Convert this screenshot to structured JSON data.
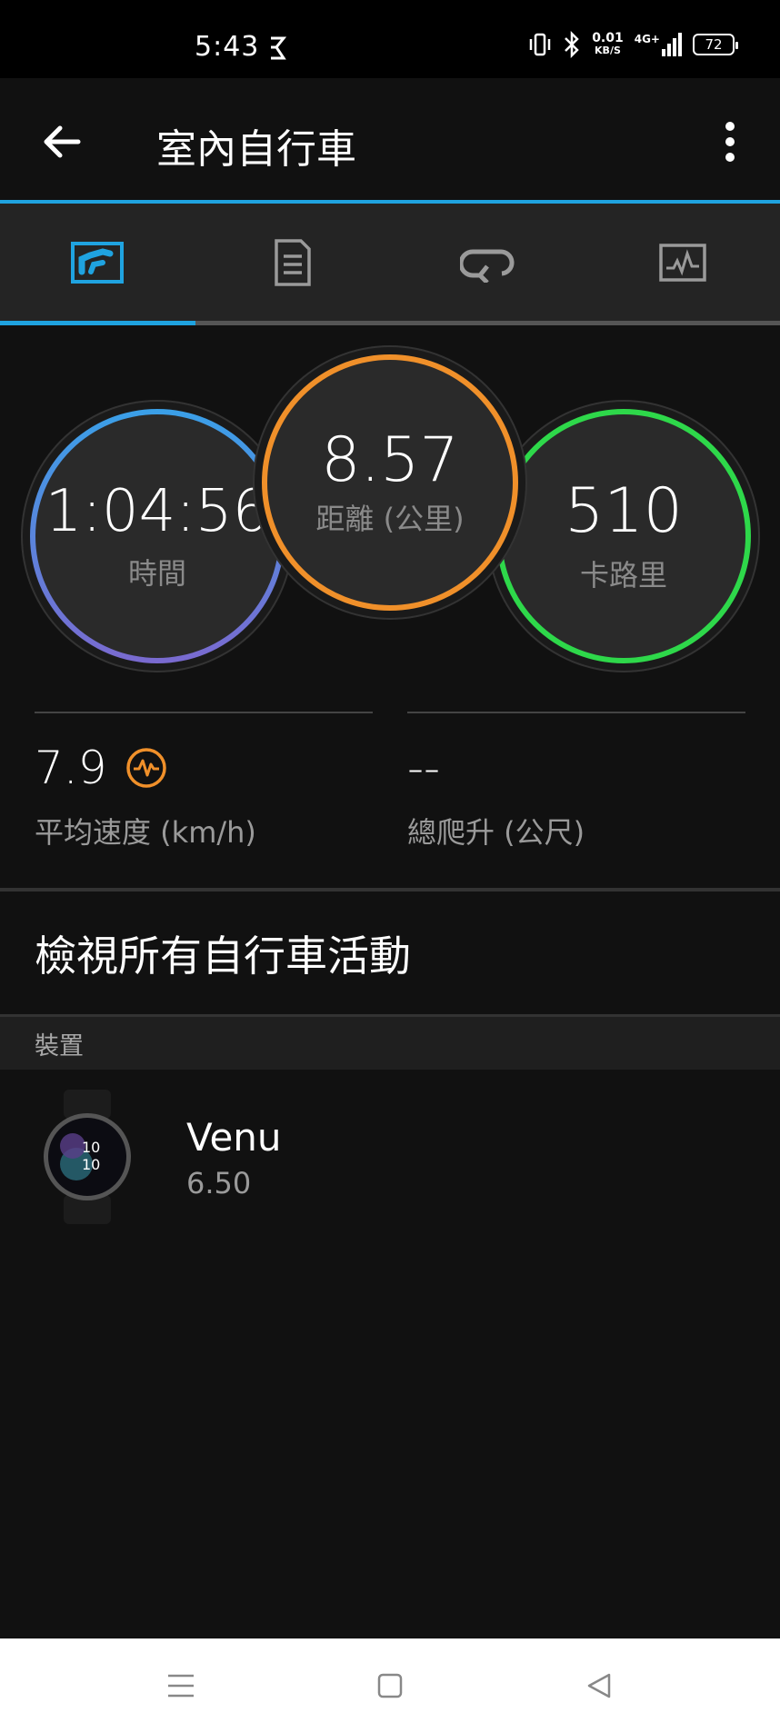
{
  "status_bar": {
    "time": "5:43",
    "net_speed_value": "0.01",
    "net_speed_unit": "KB/S",
    "network": "4G+",
    "battery": "72"
  },
  "app_bar": {
    "title": "室內自行車"
  },
  "tabs": [
    {
      "icon": "stats-chart-icon",
      "active": true
    },
    {
      "icon": "document-list-icon",
      "active": false
    },
    {
      "icon": "laps-loop-icon",
      "active": false
    },
    {
      "icon": "activity-graph-icon",
      "active": false
    }
  ],
  "rings": {
    "time": {
      "value": "1:04:56",
      "label": "時間"
    },
    "distance": {
      "value": "8.57",
      "label": "距離 (公里)"
    },
    "calories": {
      "value": "510",
      "label": "卡路里"
    }
  },
  "stats": {
    "avg_speed": {
      "value": "7.9",
      "label": "平均速度 (km/h)"
    },
    "total_ascent": {
      "value": "--",
      "label": "總爬升 (公尺)"
    }
  },
  "view_all_label": "檢視所有自行車活動",
  "device_section": {
    "header": "裝置",
    "name": "Venu",
    "version": "6.50",
    "watch_face_time_hour": "10",
    "watch_face_time_minute": "10"
  },
  "colors": {
    "accent": "#1fa3e0",
    "distance_ring": "#f0902a",
    "calories_ring": "#2ed84a",
    "time_ring_top": "#3aa0e8",
    "time_ring_bottom": "#7a6ad0"
  }
}
